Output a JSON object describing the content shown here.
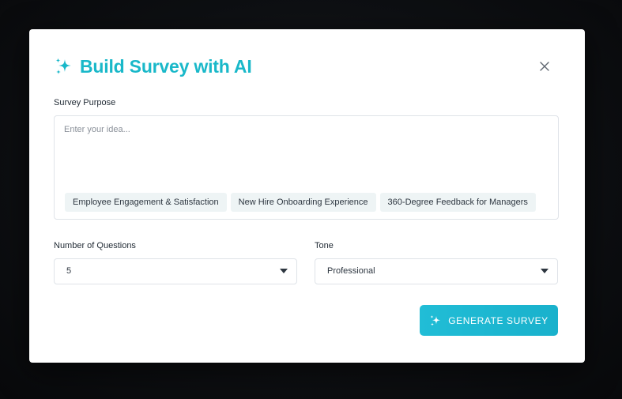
{
  "dialog": {
    "title": "Build Survey with AI",
    "title_icon": "sparkle-icon",
    "close_icon": "close-icon"
  },
  "purpose": {
    "label": "Survey Purpose",
    "placeholder": "Enter your idea...",
    "value": "",
    "suggestions": [
      "Employee Engagement & Satisfaction",
      "New Hire Onboarding Experience",
      "360-Degree Feedback for Managers"
    ]
  },
  "questions": {
    "label": "Number of Questions",
    "selected": "5"
  },
  "tone": {
    "label": "Tone",
    "selected": "Professional"
  },
  "generate_button": {
    "label": "GENERATE SURVEY",
    "icon": "sparkle-icon"
  },
  "colors": {
    "accent": "#19b8c9",
    "button": "#1fb8d2",
    "chip_bg": "#eef4f5"
  }
}
